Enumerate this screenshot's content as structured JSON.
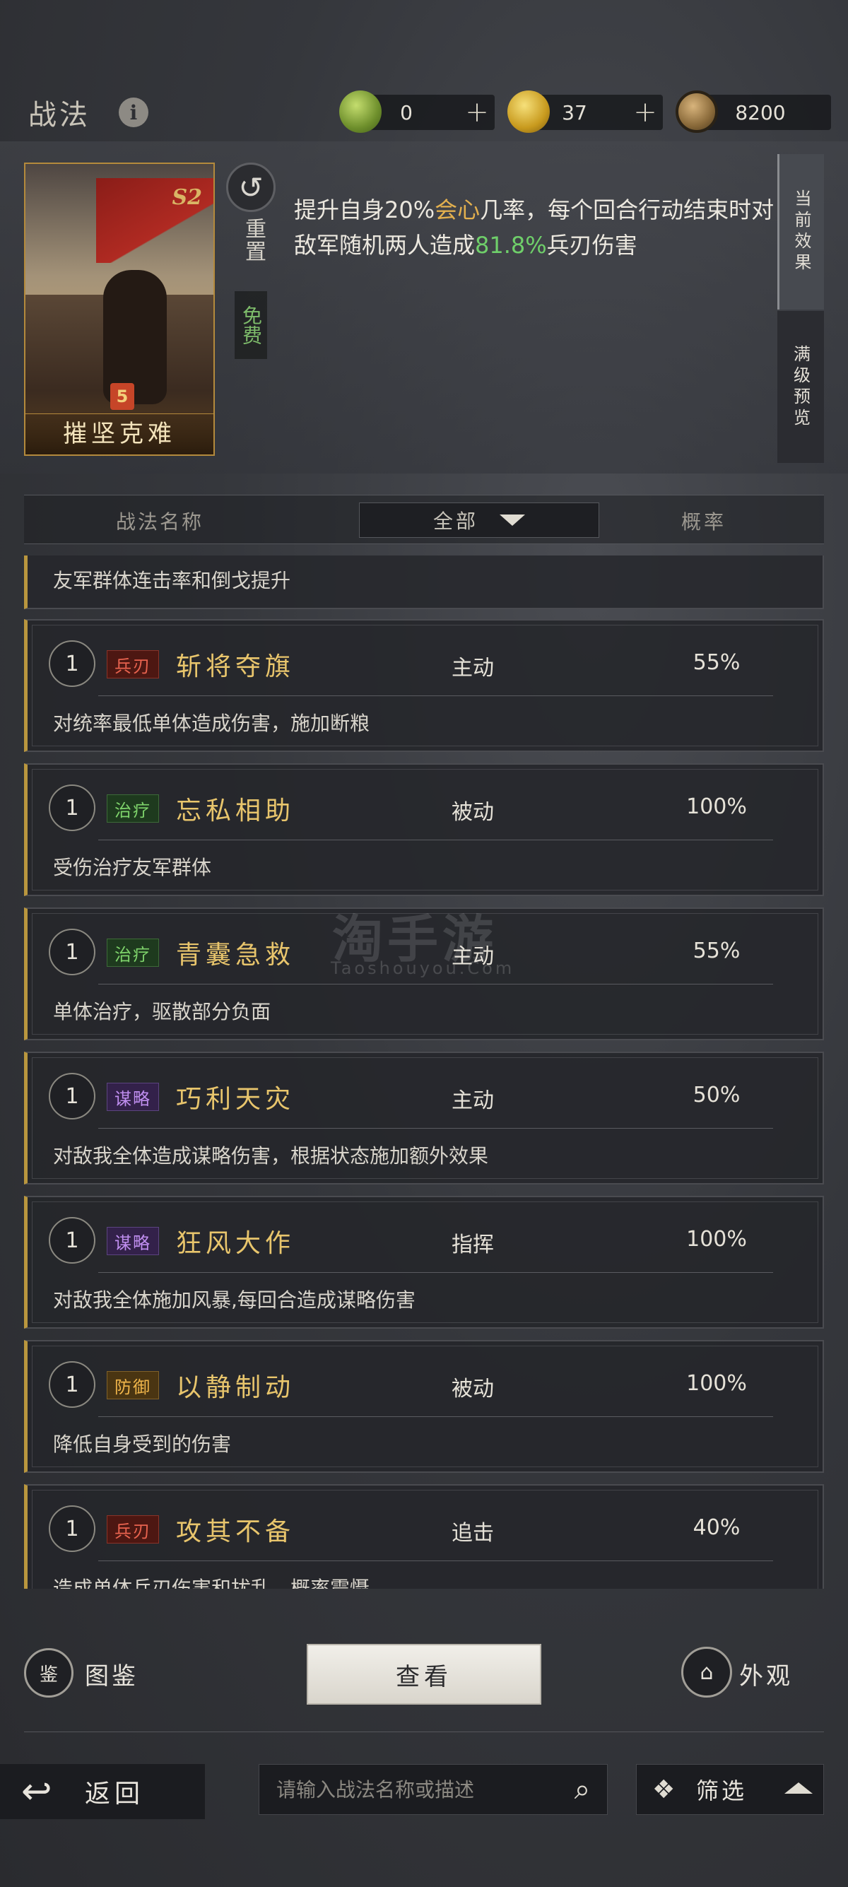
{
  "header": {
    "title": "战法",
    "currencies": [
      {
        "icon": "jade-coin-icon",
        "value": "0",
        "has_plus": true,
        "color": "#7fa33c"
      },
      {
        "icon": "gold-coin-icon",
        "value": "37",
        "has_plus": true,
        "color": "#d9b12b"
      },
      {
        "icon": "copper-coin-icon",
        "value": "8200",
        "has_plus": false,
        "color": "#8a6a3a"
      }
    ]
  },
  "top_panel": {
    "card": {
      "name": "摧坚克难",
      "season": "S2",
      "level": "5"
    },
    "reset": {
      "label": "重置",
      "cost": "免费"
    },
    "effect": {
      "part1": "提升自身20%",
      "highlight1": "会心",
      "part2": "几率，每个回合行动结束时对敌军随机两人造成",
      "highlight2": "81.8%",
      "part3": "兵刃伤害"
    },
    "tabs": [
      {
        "label": "当前效果",
        "active": true
      },
      {
        "label": "满级预览",
        "active": false
      }
    ]
  },
  "list_header": {
    "name_col": "战法名称",
    "filter": "全部",
    "rate_col": "概率"
  },
  "list": {
    "partial_top_desc": "友军群体连击率和倒戈提升",
    "items": [
      {
        "level": "1",
        "tag": "兵刃",
        "tag_kind": "bing",
        "name": "斩将夺旗",
        "type": "主动",
        "rate": "55%",
        "desc": "对统率最低单体造成伤害，施加断粮"
      },
      {
        "level": "1",
        "tag": "治疗",
        "tag_kind": "zhi",
        "name": "忘私相助",
        "type": "被动",
        "rate": "100%",
        "desc": "受伤治疗友军群体"
      },
      {
        "level": "1",
        "tag": "治疗",
        "tag_kind": "zhi",
        "name": "青囊急救",
        "type": "主动",
        "rate": "55%",
        "desc": "单体治疗，驱散部分负面"
      },
      {
        "level": "1",
        "tag": "谋略",
        "tag_kind": "mou",
        "name": "巧利天灾",
        "type": "主动",
        "rate": "50%",
        "desc": "对敌我全体造成谋略伤害，根据状态施加额外效果"
      },
      {
        "level": "1",
        "tag": "谋略",
        "tag_kind": "mou",
        "name": "狂风大作",
        "type": "指挥",
        "rate": "100%",
        "desc": "对敌我全体施加风暴,每回合造成谋略伤害"
      },
      {
        "level": "1",
        "tag": "防御",
        "tag_kind": "fang",
        "name": "以静制动",
        "type": "被动",
        "rate": "100%",
        "desc": "降低自身受到的伤害"
      },
      {
        "level": "1",
        "tag": "兵刃",
        "tag_kind": "bing",
        "name": "攻其不备",
        "type": "追击",
        "rate": "40%",
        "desc": "造成单体兵刃伤害和扰乱，概率震慑"
      }
    ]
  },
  "watermark": {
    "main": "淘手游",
    "sub": "Taoshouyou.Com"
  },
  "bottom": {
    "tujian": {
      "label": "图鉴",
      "icon_glyph": "鉴"
    },
    "view_button": "查看",
    "waiguan": {
      "label": "外观",
      "icon_glyph": "⌂"
    },
    "back": {
      "label": "返回",
      "icon_glyph": "↩"
    },
    "search_placeholder": "请输入战法名称或描述",
    "filter_label": "筛选",
    "filter_icon_glyph": "❖",
    "search_icon_glyph": "⌕"
  }
}
